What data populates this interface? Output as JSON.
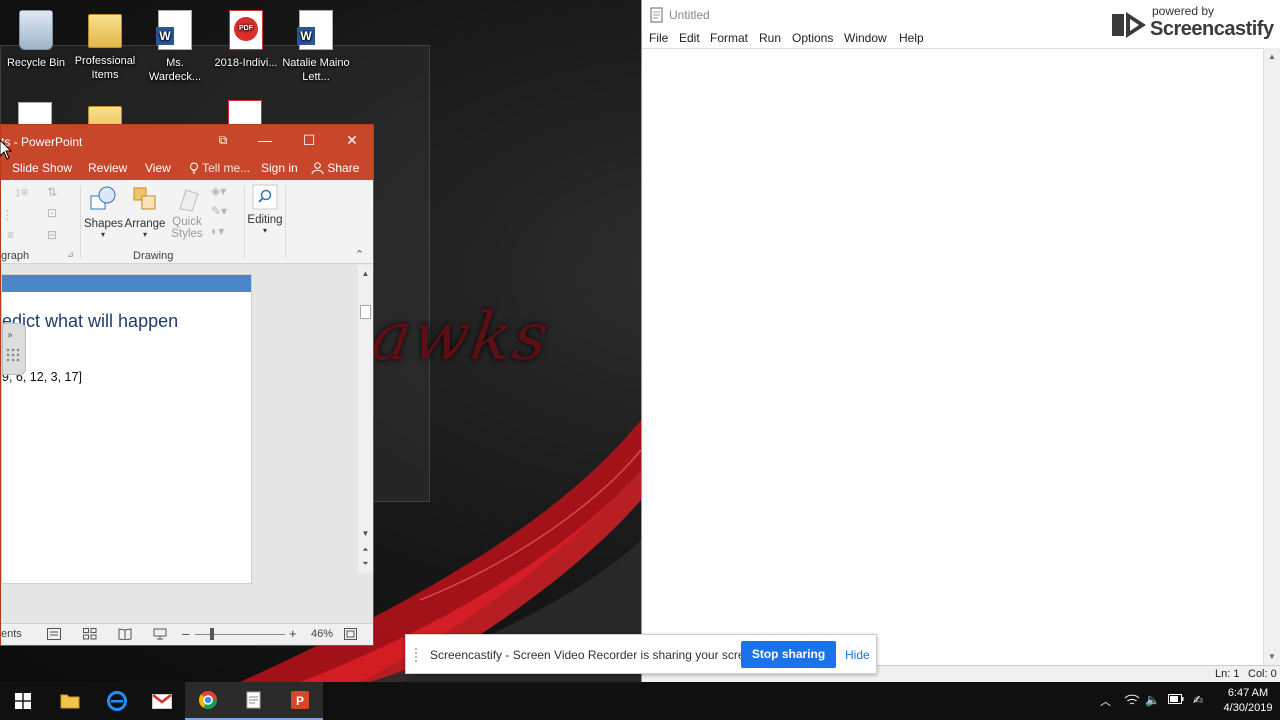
{
  "desktop": {
    "wallpaper_text": "awks",
    "icons": [
      {
        "label": "Recycle Bin",
        "kind": "bin"
      },
      {
        "label": "Professional Items",
        "kind": "folder"
      },
      {
        "label": "Ms. Wardeck...",
        "kind": "word"
      },
      {
        "label": "2018-Indivi...",
        "kind": "pdf"
      },
      {
        "label": "Natalie Maino Lett...",
        "kind": "word"
      }
    ]
  },
  "powerpoint": {
    "title": "ts - PowerPoint",
    "window_buttons": {
      "restore": "⧉",
      "minimize": "—",
      "maximize": "☐",
      "close": "✕"
    },
    "tabs": [
      "Slide Show",
      "Review",
      "View"
    ],
    "tell_me": "Tell me...",
    "sign_in": "Sign in",
    "share": "Share",
    "ribbon": {
      "shapes": "Shapes",
      "arrange": "Arrange",
      "quick_styles_1": "Quick",
      "quick_styles_2": "Styles",
      "editing": "Editing",
      "group_paragraph": "graph",
      "group_drawing": "Drawing"
    },
    "slide": {
      "heading": "edict what will happen",
      "list_text": "9, 6, 12, 3, 17]"
    },
    "status": {
      "left": "ents",
      "zoom": "46%"
    }
  },
  "editor": {
    "title": "Untitled",
    "menu": [
      "File",
      "Edit",
      "Format",
      "Run",
      "Options",
      "Window",
      "Help"
    ],
    "status": {
      "line": "Ln: 1",
      "col": "Col: 0"
    },
    "brand": {
      "powered": "powered by",
      "name": "Screencastify"
    }
  },
  "sharebar": {
    "message": "Screencastify - Screen Video Recorder is sharing your screen.",
    "stop": "Stop sharing",
    "hide": "Hide"
  },
  "taskbar": {
    "time": "6:47 AM",
    "date": "4/30/2019"
  },
  "colors": {
    "ppt_accent": "#c8462a",
    "slide_band": "#4a86c8",
    "share_blue": "#1a73e8"
  }
}
